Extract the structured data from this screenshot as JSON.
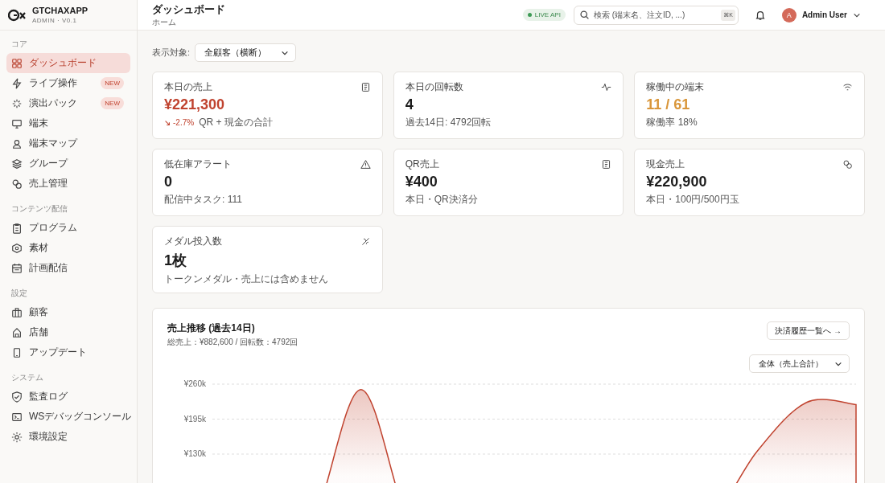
{
  "brand": {
    "name": "GTCHAXAPP",
    "version": "ADMIN · V0.1"
  },
  "sidebar": {
    "sections": [
      {
        "label": "コア",
        "items": [
          {
            "label": "ダッシュボード",
            "selected": true
          },
          {
            "label": "ライブ操作",
            "selected": false,
            "badge": "NEW"
          },
          {
            "label": "演出パック",
            "selected": false,
            "badge": "NEW"
          },
          {
            "label": "端末",
            "selected": false
          },
          {
            "label": "端末マップ",
            "selected": false
          },
          {
            "label": "グループ",
            "selected": false
          },
          {
            "label": "売上管理",
            "selected": false
          }
        ]
      },
      {
        "label": "コンテンツ配信",
        "items": [
          {
            "label": "プログラム",
            "selected": false
          },
          {
            "label": "素材",
            "selected": false
          },
          {
            "label": "計画配信",
            "selected": false
          }
        ]
      },
      {
        "label": "設定",
        "items": [
          {
            "label": "顧客",
            "selected": false
          },
          {
            "label": "店舗",
            "selected": false
          },
          {
            "label": "アップデート",
            "selected": false
          }
        ]
      },
      {
        "label": "システム",
        "items": [
          {
            "label": "監査ログ",
            "selected": false
          },
          {
            "label": "WSデバッグコンソール",
            "selected": false
          },
          {
            "label": "環境設定",
            "selected": false
          }
        ]
      }
    ]
  },
  "header": {
    "title": "ダッシュボード",
    "breadcrumb": "ホーム",
    "status": "LIVE API",
    "search": {
      "placeholder": "検索 (端末名、注文ID, ...)",
      "shortcut": "⌘K"
    },
    "user": {
      "initial": "A",
      "name": "Admin User"
    }
  },
  "filter": {
    "label": "表示対象:",
    "value": "全顧客（横断）"
  },
  "cards": [
    {
      "label": "本日の売上",
      "value": "¥221,300",
      "color": "#c0432f",
      "trend": "-2.7%",
      "note": "QR + 現金の合計"
    },
    {
      "label": "本日の回転数",
      "value": "4",
      "color": "#1c1c1c",
      "note": "過去14日: 4792回転"
    },
    {
      "label": "稼働中の端末",
      "value": "11 / 61",
      "color": "#d9963a",
      "note": "稼働率 18%"
    },
    {
      "label": "低在庫アラート",
      "value": "0",
      "color": "#1c1c1c",
      "note": "配信中タスク: 111"
    },
    {
      "label": "QR売上",
      "value": "¥400",
      "color": "#1c1c1c",
      "note": "本日・QR決済分"
    },
    {
      "label": "現金売上",
      "value": "¥220,900",
      "color": "#1c1c1c",
      "note": "本日・100円/500円玉"
    },
    {
      "label": "メダル投入数",
      "value": "1枚",
      "color": "#1c1c1c",
      "note": "トークンメダル・売上には含めません"
    }
  ],
  "sales_chart": {
    "title": "売上推移 (過去14日)",
    "summary": "総売上：¥882,600 / 回転数：4792回",
    "link_button": "決済履歴一覧へ →",
    "select": "全体（売上合計）",
    "chart_data": {
      "type": "area",
      "ylim": [
        0,
        260000
      ],
      "yticks": [
        {
          "value": 130000,
          "label": "¥130k"
        },
        {
          "value": 195000,
          "label": "¥195k"
        },
        {
          "value": 260000,
          "label": "¥260k"
        }
      ],
      "series": [
        {
          "color": "#c0432f",
          "values": [
            0,
            0,
            0,
            250000,
            0,
            0,
            0,
            0,
            0,
            0,
            0,
            135000,
            226000,
            222000
          ]
        }
      ]
    }
  }
}
